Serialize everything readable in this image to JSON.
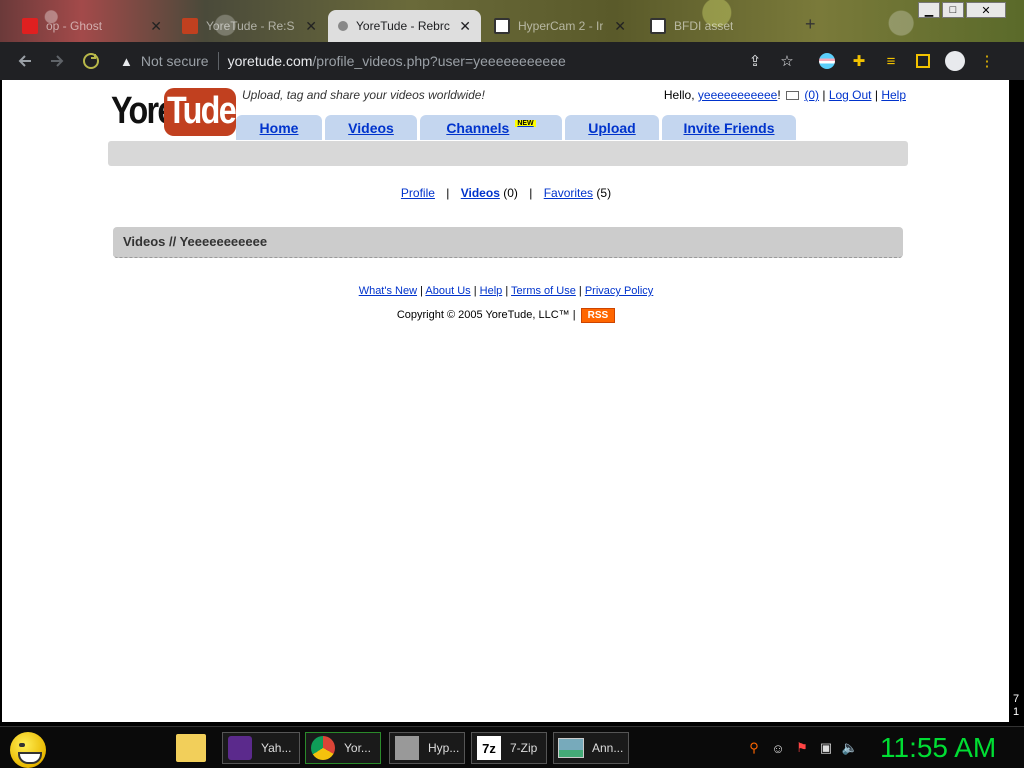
{
  "browser": {
    "tabs": [
      {
        "title": "op - Ghost",
        "active": false
      },
      {
        "title": "YoreTude - Re:S",
        "active": false
      },
      {
        "title": "YoreTude - Rebrc",
        "active": true
      },
      {
        "title": "HyperCam 2 - Ir",
        "active": false
      },
      {
        "title": "BFDI asset",
        "active": false
      }
    ],
    "new_tab": "+",
    "window_controls": [
      "▁",
      "□",
      "✕"
    ],
    "security_label": "Not secure",
    "url_host": "yoretude.com",
    "url_path": "/profile_videos.php?user=yeeeeeeeeeee"
  },
  "site": {
    "logo_left": "Yore",
    "logo_right": "Tude",
    "tagline": "Upload, tag and share your videos worldwide!",
    "hello": "Hello,",
    "username": "yeeeeeeeeeee",
    "exclaim": "!",
    "mail_count": "(0)",
    "logout": "Log Out",
    "help": "Help",
    "nav": [
      {
        "label": "Home"
      },
      {
        "label": "Videos"
      },
      {
        "label": "Channels",
        "badge": "NEW"
      },
      {
        "label": "Upload"
      },
      {
        "label": "Invite Friends"
      }
    ],
    "subnav": {
      "profile": "Profile",
      "videos": "Videos",
      "videos_count": "(0)",
      "favorites": "Favorites",
      "favorites_count": "(5)"
    },
    "videos_header": "Videos // Yeeeeeeeeeee",
    "footer": {
      "links": [
        "What's New",
        "About Us",
        "Help",
        "Terms of Use",
        "Privacy Policy"
      ],
      "copyright": "Copyright © 2005 YoreTude, LLC™ |",
      "rss": "RSS"
    }
  },
  "taskbar": {
    "items": [
      {
        "label": "Yah..."
      },
      {
        "label": "Yor..."
      },
      {
        "label": "Hyp..."
      },
      {
        "label": "7-Zip"
      },
      {
        "label": "Ann..."
      }
    ],
    "clock": "11:55 AM",
    "scroll_marks": [
      "7",
      "1"
    ]
  }
}
